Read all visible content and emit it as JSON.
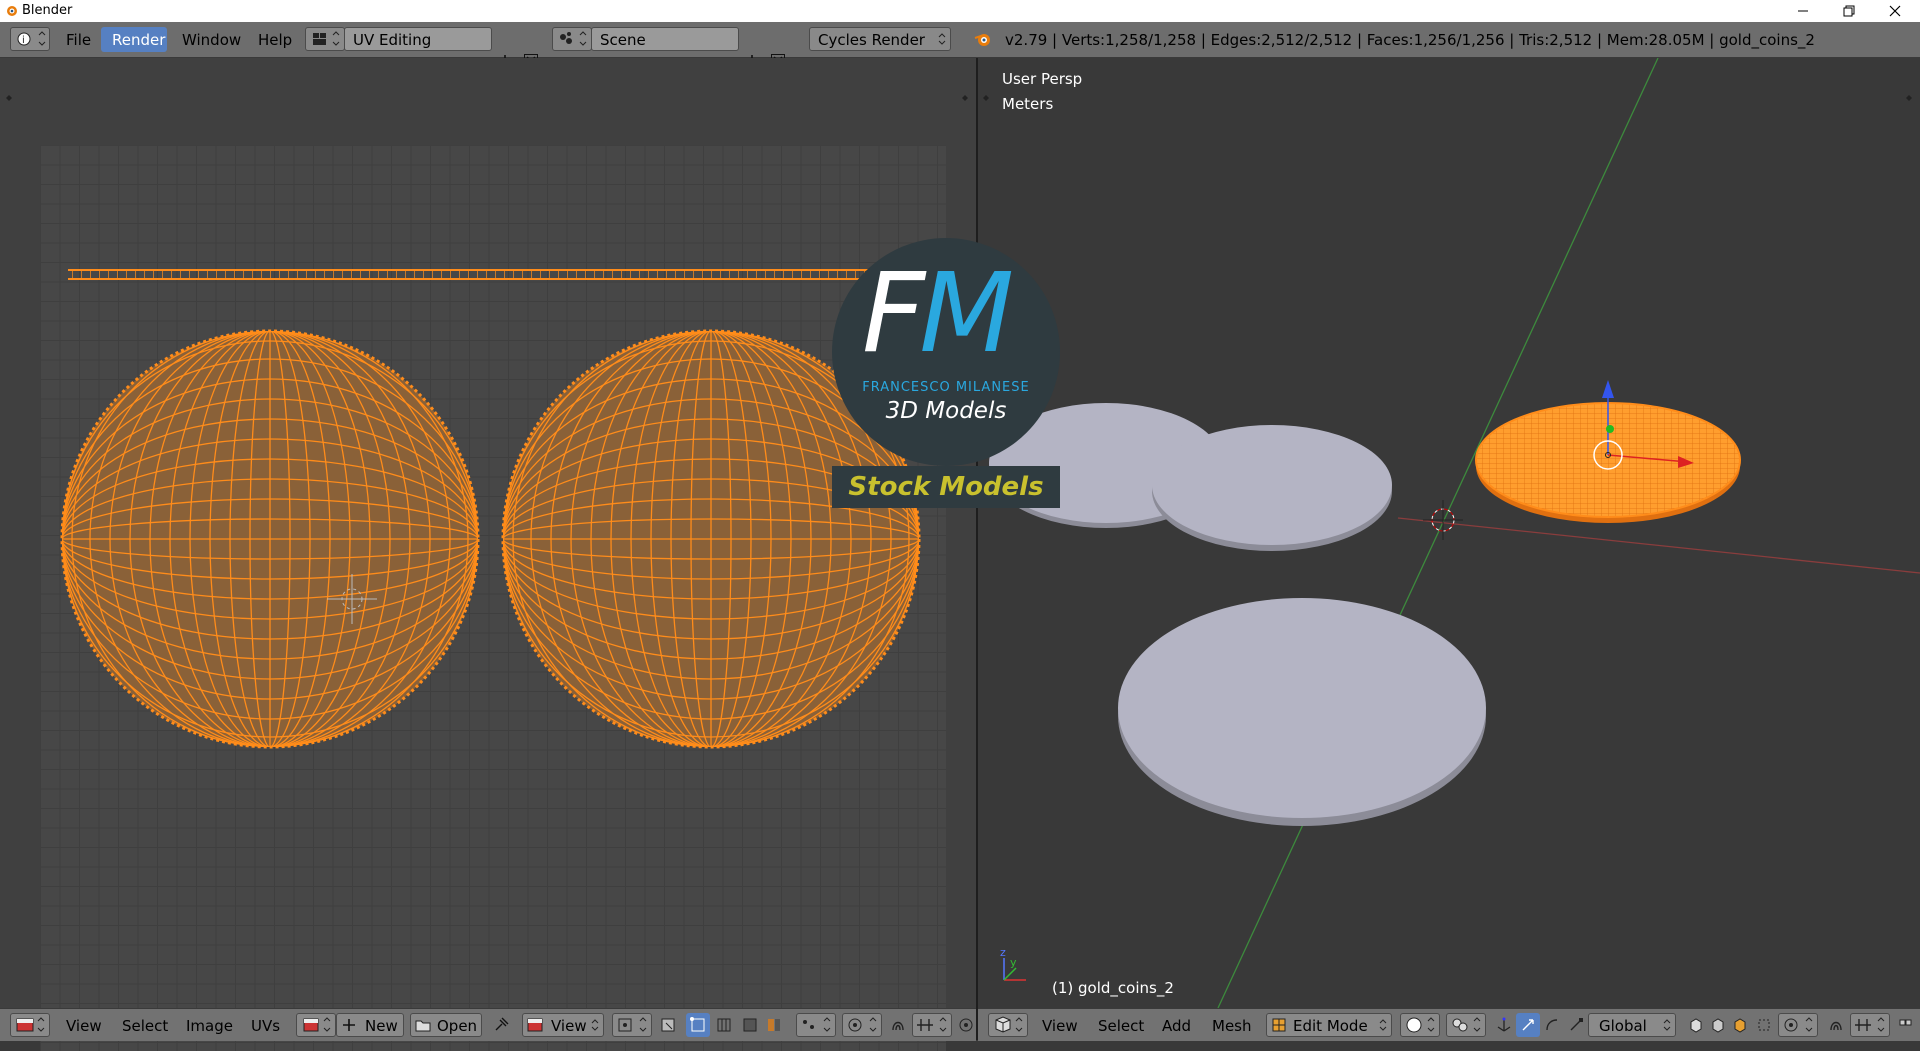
{
  "window": {
    "title": "Blender"
  },
  "topbar": {
    "menus": [
      "File",
      "Render",
      "Window",
      "Help"
    ],
    "active_menu": "Render",
    "screen_layout": "UV Editing",
    "scene": "Scene",
    "render_engine": "Cycles Render",
    "stats": "v2.79 | Verts:1,258/1,258 | Edges:2,512/2,512 | Faces:1,256/1,256 | Tris:2,512 | Mem:28.05M | gold_coins_2"
  },
  "uv_editor": {
    "menus": [
      "View",
      "Select",
      "Image",
      "UVs"
    ],
    "new_label": "New",
    "open_label": "Open",
    "view_label": "View"
  },
  "viewport": {
    "view_name": "User Persp",
    "units": "Meters",
    "object_label": "(1) gold_coins_2",
    "menus": [
      "View",
      "Select",
      "Add",
      "Mesh"
    ],
    "mode": "Edit Mode",
    "orientation": "Global"
  },
  "watermark": {
    "logo_text": "FM",
    "author": "FRANCESCO MILANESE",
    "line2": "3D Models",
    "banner": "Stock Models"
  },
  "colors": {
    "accent": "#5680c2",
    "selection": "#ff8c1a",
    "coin": "#b4b4c4"
  }
}
